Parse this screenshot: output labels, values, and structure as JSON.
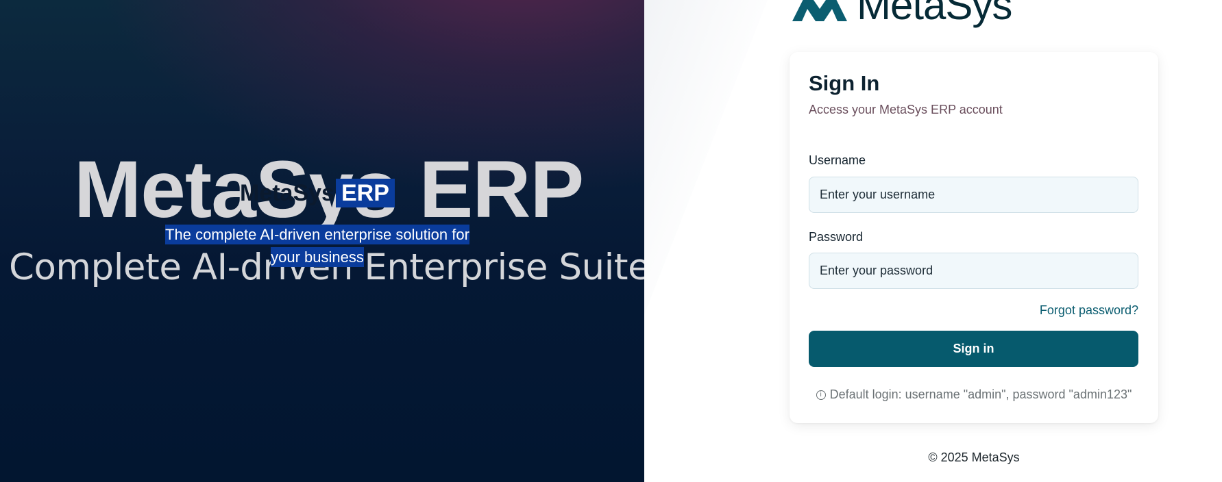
{
  "hero": {
    "big_title": "MetaSys ERP",
    "big_subtitle": "Complete AI-driven Enterprise Suite",
    "overlay_brand_name": "MetaSys",
    "overlay_brand_tag": "ERP",
    "overlay_tagline": "The complete AI-driven enterprise solution for your business"
  },
  "logo": {
    "text": "MetaSys",
    "icon": "metasys-logo-mark-icon"
  },
  "card": {
    "title": "Sign In",
    "subtitle": "Access your MetaSys ERP account",
    "username_label": "Username",
    "username_placeholder": "Enter your username",
    "password_label": "Password",
    "password_placeholder": "Enter your password",
    "forgot_link": "Forgot password?",
    "signin_button": "Sign in",
    "hint_icon": "info-icon",
    "hint_text": "Default login: username \"admin\", password \"admin123\""
  },
  "footer": {
    "copyright": "© 2025 MetaSys"
  },
  "colors": {
    "primary": "#065a6d",
    "highlight": "#0a3c9c",
    "hero_dark": "#021630",
    "hero_magenta": "#682450"
  }
}
